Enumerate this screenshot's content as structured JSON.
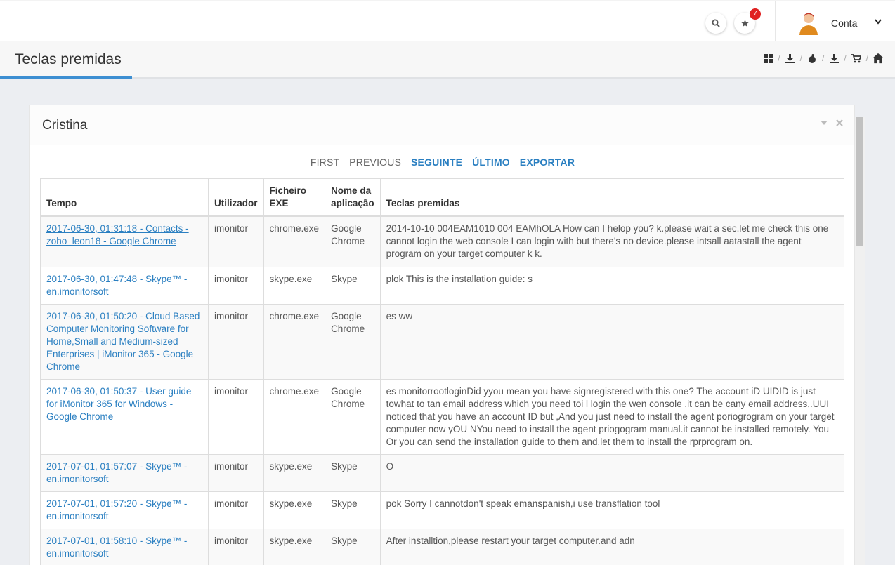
{
  "header": {
    "notification_count": "7",
    "account_label": "Conta"
  },
  "page": {
    "title": "Teclas premidas"
  },
  "portlet": {
    "title": "Cristina"
  },
  "pager": {
    "first": "FIRST",
    "previous": "PREVIOUS",
    "next": "SEGUINTE",
    "last": "ÚLTIMO",
    "export": "EXPORTAR"
  },
  "table": {
    "columns": [
      "Tempo",
      "Utilizador",
      "Ficheiro EXE",
      "Nome da aplicação",
      "Teclas premidas"
    ],
    "rows": [
      {
        "time": "2017-06-30, 01:31:18 - Contacts - zoho_leon18 - Google Chrome",
        "user": "imonitor",
        "exe": "chrome.exe",
        "app": "Google Chrome",
        "keys": "2014-10-10 004EAM1010 004 EAMhOLA How can I helop you? k.please wait a sec.let me check this one cannot login the web console I can login with but there's no device.please intsall aatastall the agent program on your target computer k k."
      },
      {
        "time": "2017-06-30, 01:47:48 - Skype™ - en.imonitorsoft",
        "user": "imonitor",
        "exe": "skype.exe",
        "app": "Skype",
        "keys": "plok This is the installation guide: s"
      },
      {
        "time": "2017-06-30, 01:50:20 - Cloud Based Computer Monitoring Software for Home,Small and Medium-sized Enterprises | iMonitor 365 - Google Chrome",
        "user": "imonitor",
        "exe": "chrome.exe",
        "app": "Google Chrome",
        "keys": "es ww"
      },
      {
        "time": "2017-06-30, 01:50:37 - User guide for iMonitor 365 for Windows - Google Chrome",
        "user": "imonitor",
        "exe": "chrome.exe",
        "app": "Google Chrome",
        "keys": "es monitorrootloginDid yyou mean you have signregistered with this one? The account iD UIDID is just towhat to tan email address which you need toi l login the wen console ,it can be cany email address,.UUI noticed that you have an account ID but ,And you just need to install the agent poriogrogram on your target computer now yOU NYou need to install the agent priogogram manual.it cannot be installed remotely. You Or you can send the installation guide to them and.let them to install the rprprogram on."
      },
      {
        "time": "2017-07-01, 01:57:07 - Skype™ - en.imonitorsoft",
        "user": "imonitor",
        "exe": "skype.exe",
        "app": "Skype",
        "keys": "O"
      },
      {
        "time": "2017-07-01, 01:57:20 - Skype™ - en.imonitorsoft",
        "user": "imonitor",
        "exe": "skype.exe",
        "app": "Skype",
        "keys": "pok Sorry I cannotdon't speak emanspanish,i use transflation tool"
      },
      {
        "time": "2017-07-01, 01:58:10 - Skype™ - en.imonitorsoft",
        "user": "imonitor",
        "exe": "skype.exe",
        "app": "Skype",
        "keys": "After installtion,please restart your target computer.and adn"
      }
    ]
  }
}
